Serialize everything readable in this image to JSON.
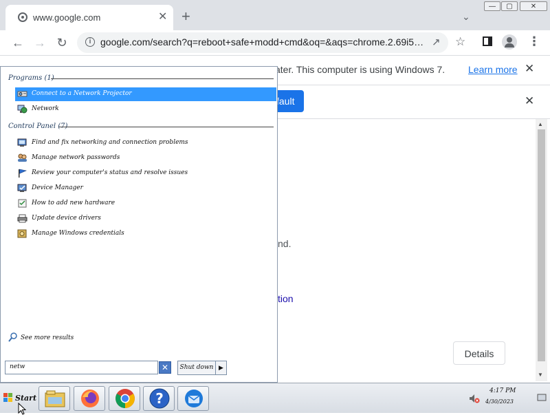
{
  "browser": {
    "tab_title": "www.google.com",
    "tab_close": "✕",
    "new_tab": "+",
    "tab_search": "⌄",
    "window_controls": [
      "—",
      "▢",
      "✕"
    ],
    "url": "google.com/search?q=reboot+safe+modd+cmd&oq=&aqs=chrome.2.69i5…",
    "infobar_text": "ater. This computer is using Windows 7.",
    "learn_more": "Learn more",
    "infobar_button": "fault",
    "page_text": "nd.",
    "page_link": "tion",
    "details_button": "Details"
  },
  "start_menu": {
    "programs_header": "Programs (1)",
    "programs": [
      {
        "label": "Connect to a Network Projector",
        "icon": "projector-icon",
        "selected": true
      },
      {
        "label": "Network",
        "icon": "network-globe-icon",
        "selected": false
      }
    ],
    "control_panel_header": "Control Panel (7)",
    "control_panel": [
      {
        "label": "Find and fix networking and connection problems",
        "icon": "network-troubleshoot-icon"
      },
      {
        "label": "Manage network passwords",
        "icon": "users-icon"
      },
      {
        "label": "Review your computer's status and resolve issues",
        "icon": "action-center-flag-icon"
      },
      {
        "label": "Device Manager",
        "icon": "device-manager-icon"
      },
      {
        "label": "How to add new hardware",
        "icon": "checklist-icon"
      },
      {
        "label": "Update device drivers",
        "icon": "printer-icon"
      },
      {
        "label": "Manage Windows credentials",
        "icon": "credential-vault-icon"
      }
    ],
    "see_more": "See more results",
    "search_value": "netw",
    "clear_glyph": "✕",
    "shutdown_label": "Shut down",
    "shutdown_arrow": "▶"
  },
  "taskbar": {
    "start_label": "Start",
    "apps": [
      "windows-explorer-icon",
      "firefox-icon",
      "chrome-icon",
      "help-icon",
      "thunderbird-icon"
    ],
    "clock_time": "4:17 PM",
    "clock_date": "4/30/2023"
  }
}
